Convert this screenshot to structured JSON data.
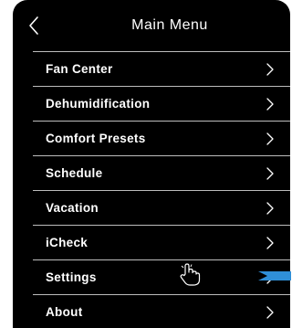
{
  "header": {
    "title": "Main Menu",
    "back_icon": "chevron-left-icon"
  },
  "menu": {
    "items": [
      {
        "label": "Fan Center",
        "icon": "chevron-right-icon"
      },
      {
        "label": "Dehumidification",
        "icon": "chevron-right-icon"
      },
      {
        "label": "Comfort Presets",
        "icon": "chevron-right-icon"
      },
      {
        "label": "Schedule",
        "icon": "chevron-right-icon"
      },
      {
        "label": "Vacation",
        "icon": "chevron-right-icon"
      },
      {
        "label": "iCheck",
        "icon": "chevron-right-icon"
      },
      {
        "label": "Settings",
        "icon": "chevron-right-icon"
      },
      {
        "label": "About",
        "icon": "chevron-right-icon"
      }
    ]
  },
  "overlays": {
    "tap_indicator_icon": "hand-pointer-icon",
    "callout_icon": "arrow-pointer-icon",
    "callout_color": "#2f8fd8"
  },
  "colors": {
    "background": "#000000",
    "text": "#ffffff",
    "divider": "#bdbdbd"
  }
}
